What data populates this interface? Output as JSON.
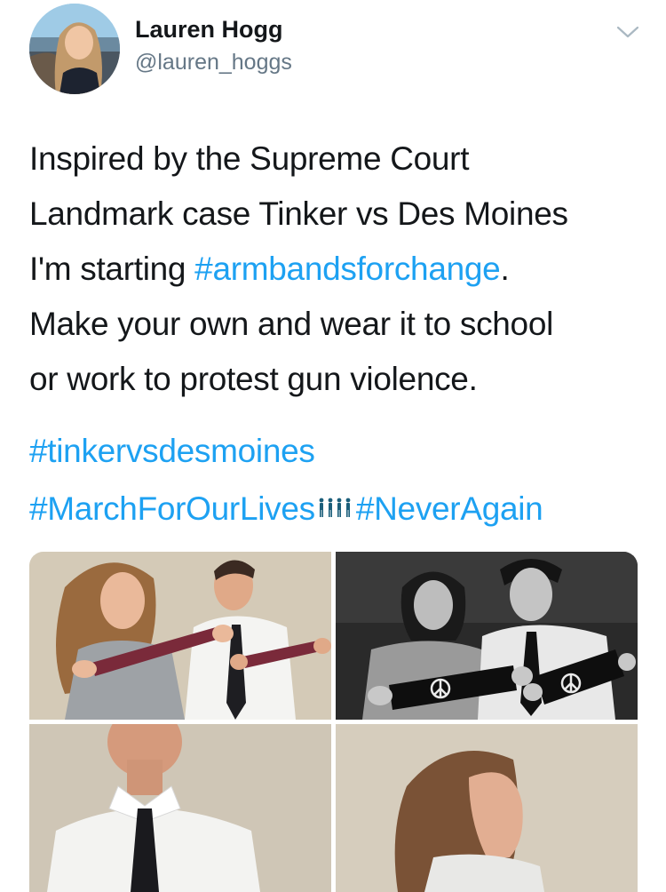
{
  "author": {
    "display_name": "Lauren Hogg",
    "handle": "@lauren_hoggs"
  },
  "tweet": {
    "lines": [
      "Inspired by the Supreme Court",
      "Landmark case Tinker vs Des Moines",
      "I'm starting ",
      "Make your own and wear it to school",
      "or work to protest gun violence."
    ],
    "inline_hashtag": "#armbandsforchange",
    "inline_hashtag_suffix": ".",
    "hashtags": {
      "tinker": "#tinkervsdesmoines",
      "march": "#MarchForOurLives",
      "never_again": "#NeverAgain"
    }
  },
  "colors": {
    "link": "#1da1f2",
    "muted": "#657786",
    "text": "#14171a"
  },
  "icons": {
    "menu": "chevron-down-icon",
    "march_emoji": "people-group-icon"
  }
}
